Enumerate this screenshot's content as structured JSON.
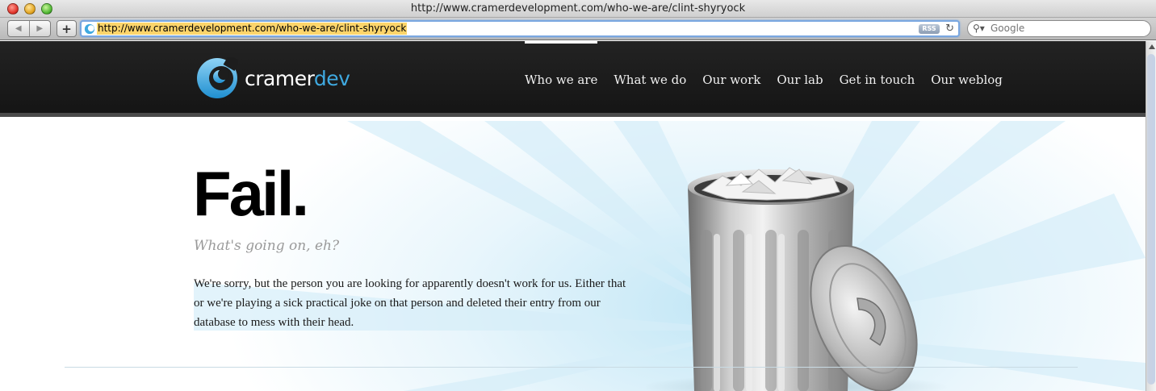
{
  "window": {
    "title": "http://www.cramerdevelopment.com/who-we-are/clint-shyryock"
  },
  "toolbar": {
    "back_label": "◀",
    "forward_label": "▶",
    "add_label": "+",
    "url": "http://www.cramerdevelopment.com/who-we-are/clint-shyryock",
    "rss_label": "RSS",
    "reload_label": "↻",
    "search_placeholder": "Google"
  },
  "site": {
    "logo_part1": "cramer",
    "logo_part2": "dev",
    "nav": [
      {
        "label": "Who we are",
        "active": true
      },
      {
        "label": "What we do",
        "active": false
      },
      {
        "label": "Our work",
        "active": false
      },
      {
        "label": "Our lab",
        "active": false
      },
      {
        "label": "Get in touch",
        "active": false
      },
      {
        "label": "Our weblog",
        "active": false
      }
    ],
    "colors": {
      "header_bg": "#1b1b1b",
      "logo_accent": "#3fa9e0",
      "hero_glow": "#b7e2f4"
    }
  },
  "content": {
    "heading": "Fail.",
    "subtitle": "What's going on, eh?",
    "body": "We're sorry, but the person you are looking for apparently doesn't work for us. Either that or we're playing a sick practical joke on that person and deleted their entry from our database to mess with their head.",
    "illustration": "trash-can"
  }
}
